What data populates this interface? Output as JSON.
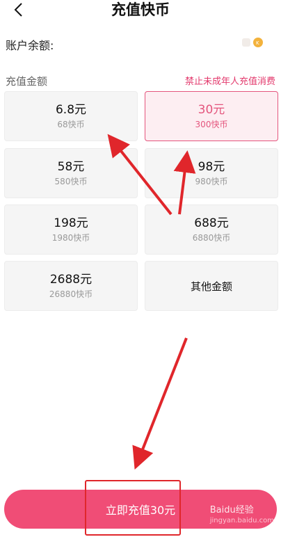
{
  "header": {
    "title": "充值快币"
  },
  "balance": {
    "label": "账户余额:"
  },
  "section": {
    "label": "充值金额",
    "notice": "禁止未成年人充值消费"
  },
  "options": [
    {
      "amount": "6.8元",
      "coins": "68快币",
      "selected": false
    },
    {
      "amount": "30元",
      "coins": "300快币",
      "selected": true
    },
    {
      "amount": "58元",
      "coins": "580快币",
      "selected": false
    },
    {
      "amount": "98元",
      "coins": "980快币",
      "selected": false
    },
    {
      "amount": "198元",
      "coins": "1980快币",
      "selected": false
    },
    {
      "amount": "688元",
      "coins": "6880快币",
      "selected": false
    },
    {
      "amount": "2688元",
      "coins": "26880快币",
      "selected": false
    }
  ],
  "other_option": {
    "label": "其他金额"
  },
  "pay_button": {
    "label": "立即充值30元"
  },
  "watermark": {
    "brand": "Baidu经验",
    "url": "jingyan.baidu.com"
  },
  "colors": {
    "accent": "#f04d76",
    "selected_border": "#e4557d",
    "annotation_red": "#e0262b",
    "coin": "#f3b23c"
  },
  "icons": {
    "back": "chevron-left-icon",
    "coin": "coin-icon"
  }
}
